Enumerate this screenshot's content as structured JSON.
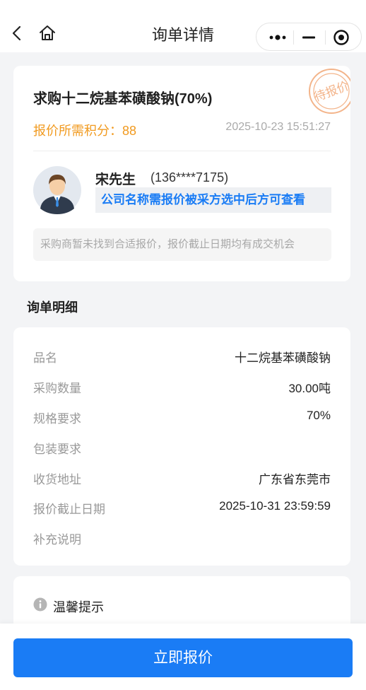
{
  "nav": {
    "title": "询单详情"
  },
  "inquiry": {
    "title": "求购十二烷基苯磺酸钠(70%)",
    "stamp_text": "待报价",
    "points_label": "报价所需积分：",
    "points_value": "88",
    "datetime": "2025-10-23 15:51:27",
    "contact_name": "宋先生",
    "contact_phone": "(136****7175)",
    "company_note": "公司名称需报价被采方选中后方可查看",
    "notice": "采购商暂未找到合适报价，报价截止日期均有成交机会"
  },
  "details": {
    "section_title": "询单明细",
    "rows": [
      {
        "label": "品名",
        "value": "十二烷基苯磺酸钠"
      },
      {
        "label": "采购数量",
        "value": "30.00吨"
      },
      {
        "label": "规格要求",
        "value": "70%"
      },
      {
        "label": "包装要求",
        "value": ""
      },
      {
        "label": "收货地址",
        "value": "广东省东莞市"
      },
      {
        "label": "报价截止日期",
        "value": "2025-10-31 23:59:59"
      },
      {
        "label": "补充说明",
        "value": ""
      }
    ]
  },
  "tips": {
    "title": "温馨提示"
  },
  "actions": {
    "quote_label": "立即报价"
  },
  "colors": {
    "accent": "#1a7cf5",
    "points": "#f19a1f",
    "stamp": "#f3b48a"
  }
}
